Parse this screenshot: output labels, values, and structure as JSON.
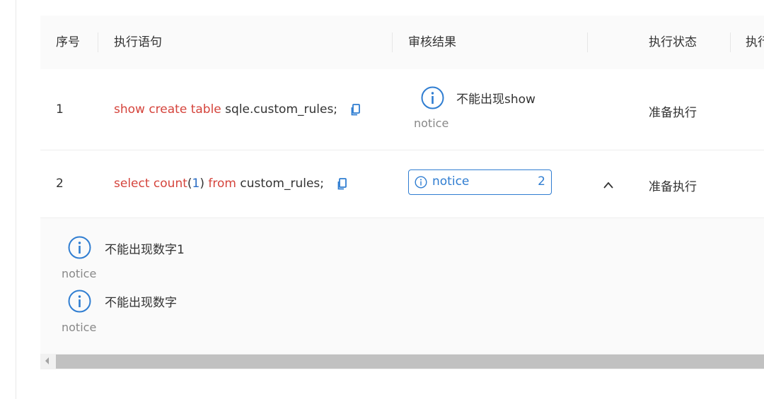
{
  "colors": {
    "keyword": "#d5443c",
    "number": "#2a6cc4",
    "accent": "#2f7dd1",
    "muted": "#888888"
  },
  "columns": {
    "index": "序号",
    "statement": "执行语句",
    "audit": "审核结果",
    "exec_status": "执行状态",
    "truncated": "执行"
  },
  "rows": [
    {
      "index": "1",
      "sql_parts": {
        "kw1": "show create table",
        "rest": " sqle.custom_rules;"
      },
      "audit": {
        "message": "不能出现show",
        "level": "notice"
      },
      "status": "准备执行"
    },
    {
      "index": "2",
      "sql_parts": {
        "kw1": "select",
        "fn": "count",
        "open": "(",
        "num": "1",
        "close": ")",
        "kw2": "from",
        "rest": " custom_rules;"
      },
      "audit_tag": {
        "label": "notice",
        "count": "2"
      },
      "collapse_icon": "chevron-up-icon",
      "status": "准备执行",
      "details": [
        {
          "message": "不能出现数字1",
          "level": "notice"
        },
        {
          "message": "不能出现数字",
          "level": "notice"
        }
      ]
    }
  ],
  "icons": {
    "copy": "copy-icon",
    "info": "info-circle-icon"
  }
}
